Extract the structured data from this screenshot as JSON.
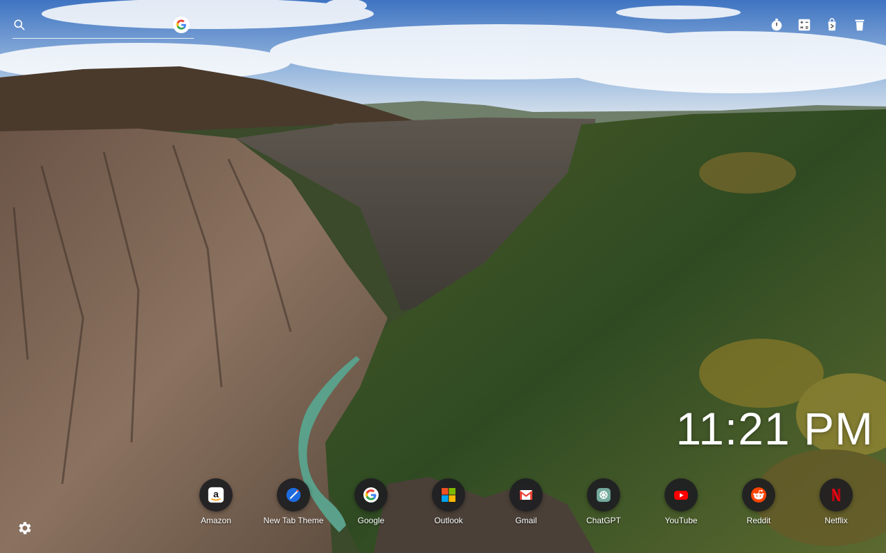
{
  "search": {
    "placeholder": "",
    "value": "",
    "engine_letter": "G"
  },
  "toolbar": {
    "items": [
      {
        "icon": "timer-icon"
      },
      {
        "icon": "calculator-icon"
      },
      {
        "icon": "shop-bag-icon"
      },
      {
        "icon": "trash-icon"
      }
    ]
  },
  "clock": {
    "time": "11:21 PM"
  },
  "shortcuts": [
    {
      "label": "Amazon",
      "icon": "amazon-icon"
    },
    {
      "label": "New Tab Theme",
      "icon": "new-tab-theme-icon"
    },
    {
      "label": "Google",
      "icon": "google-icon"
    },
    {
      "label": "Outlook",
      "icon": "outlook-icon"
    },
    {
      "label": "Gmail",
      "icon": "gmail-icon"
    },
    {
      "label": "ChatGPT",
      "icon": "chatgpt-icon"
    },
    {
      "label": "YouTube",
      "icon": "youtube-icon"
    },
    {
      "label": "Reddit",
      "icon": "reddit-icon"
    },
    {
      "label": "Netflix",
      "icon": "netflix-icon"
    }
  ],
  "colors": {
    "sky": "#4f7fbf",
    "clock_text": "#ffffff",
    "dock_bubble": "#1e1e22"
  }
}
